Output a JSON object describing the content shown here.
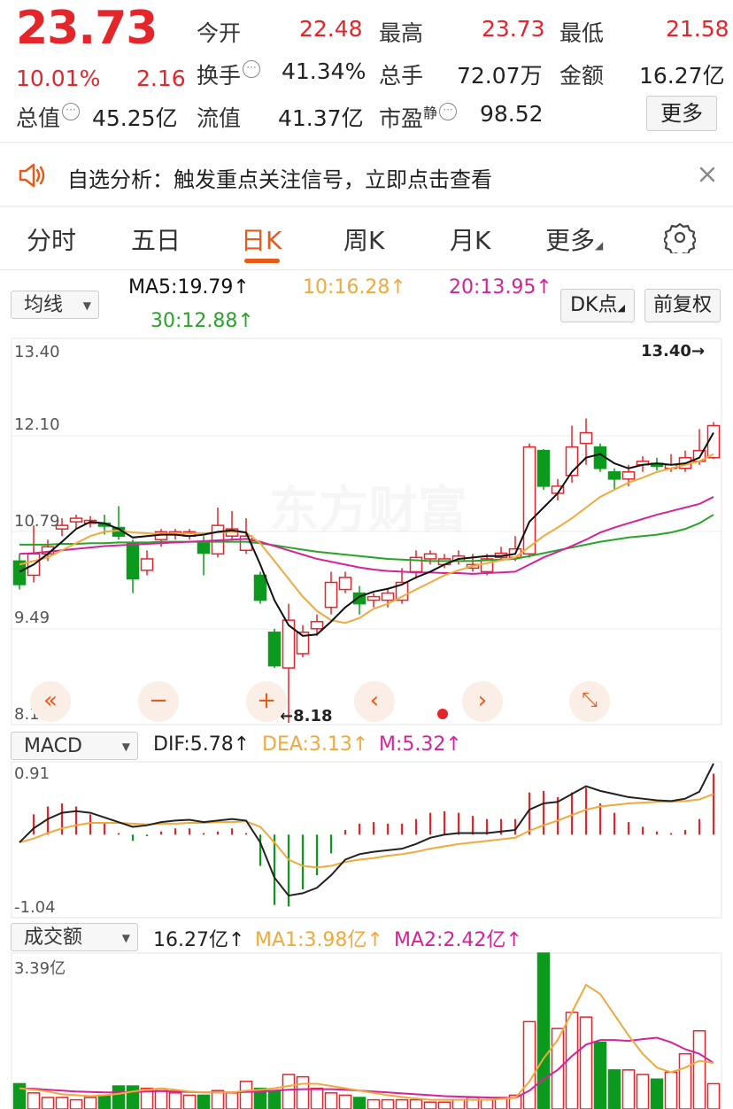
{
  "quote": {
    "price": "23.73",
    "change_pct": "10.01%",
    "change_amt": "2.16",
    "stats": [
      {
        "label": "今开",
        "value": "22.48"
      },
      {
        "label": "最高",
        "value": "23.73"
      },
      {
        "label": "最低",
        "value": "21.58"
      },
      {
        "label": "换手",
        "value": "41.34%"
      },
      {
        "label": "总手",
        "value": "72.07万"
      },
      {
        "label": "金额",
        "value": "16.27亿"
      },
      {
        "label": "总值",
        "value": "45.25亿"
      },
      {
        "label": "流值",
        "value": "41.37亿"
      },
      {
        "label": "市盈",
        "value": "98.52"
      }
    ],
    "pe_superscript": "静",
    "more_label": "更多"
  },
  "banner": {
    "text": "自选分析：触发重点关注信号，立即点击查看",
    "icon": "speaker-icon",
    "close_icon": "close-icon"
  },
  "tabs": [
    "分时",
    "五日",
    "日K",
    "周K",
    "月K",
    "更多"
  ],
  "active_tab": "日K",
  "settings_icon": "gear-icon",
  "kline": {
    "selector": "均线",
    "ma5": "MA5:19.79",
    "ma10": "10:16.28",
    "ma20": "20:13.95",
    "ma30": "30:12.88",
    "dk_button": "DK点",
    "adjust_button": "前复权",
    "y_labels": [
      "13.40",
      "12.10",
      "10.79",
      "9.49",
      "8.18"
    ],
    "max_marker": "13.40",
    "min_marker": "8.18",
    "watermark": "东方财富"
  },
  "controls": [
    "rewind-icon",
    "zoom-out-icon",
    "zoom-in-icon",
    "prev-icon",
    "next-icon",
    "fullscreen-icon"
  ],
  "macd": {
    "selector": "MACD",
    "dif": "DIF:5.78",
    "dea": "DEA:3.13",
    "m": "M:5.32",
    "y_top": "0.91",
    "y_bottom": "-1.04"
  },
  "volume": {
    "selector": "成交额",
    "value": "16.27亿",
    "ma1": "MA1:3.98亿",
    "ma2": "MA2:2.42亿",
    "y_top": "3.39亿"
  },
  "colors": {
    "up": "#e4262a",
    "down": "#0b9a1d",
    "ma5": "#111111",
    "ma10": "#f2a93b",
    "ma20": "#d4239a",
    "ma30": "#28a428",
    "accent": "#e85a18"
  },
  "chart_data": {
    "type": "candlestick",
    "y_range": [
      8.18,
      13.4
    ],
    "candles": [
      {
        "o": 10.45,
        "c": 10.12,
        "h": 10.55,
        "l": 10.05
      },
      {
        "o": 10.25,
        "c": 10.55,
        "h": 10.95,
        "l": 10.15
      },
      {
        "o": 10.55,
        "c": 10.65,
        "h": 10.75,
        "l": 10.45
      },
      {
        "o": 10.9,
        "c": 10.95,
        "h": 11.05,
        "l": 10.8
      },
      {
        "o": 11.0,
        "c": 11.05,
        "h": 11.1,
        "l": 10.9
      },
      {
        "o": 10.98,
        "c": 11.02,
        "h": 11.08,
        "l": 10.92
      },
      {
        "o": 10.98,
        "c": 10.94,
        "h": 11.1,
        "l": 10.82
      },
      {
        "o": 10.92,
        "c": 10.8,
        "h": 11.22,
        "l": 10.75
      },
      {
        "o": 10.7,
        "c": 10.2,
        "h": 10.75,
        "l": 10.0
      },
      {
        "o": 10.32,
        "c": 10.48,
        "h": 10.6,
        "l": 10.25
      },
      {
        "o": 10.75,
        "c": 10.86,
        "h": 10.9,
        "l": 10.65
      },
      {
        "o": 10.82,
        "c": 10.86,
        "h": 10.9,
        "l": 10.75
      },
      {
        "o": 10.8,
        "c": 10.86,
        "h": 10.9,
        "l": 10.75
      },
      {
        "o": 10.72,
        "c": 10.56,
        "h": 10.8,
        "l": 10.25
      },
      {
        "o": 10.55,
        "c": 10.95,
        "h": 11.2,
        "l": 10.5
      },
      {
        "o": 10.8,
        "c": 10.9,
        "h": 11.15,
        "l": 10.75
      },
      {
        "o": 10.6,
        "c": 10.8,
        "h": 11.05,
        "l": 10.55
      },
      {
        "o": 10.25,
        "c": 9.9,
        "h": 10.3,
        "l": 9.85
      },
      {
        "o": 9.45,
        "c": 8.98,
        "h": 9.5,
        "l": 8.95
      },
      {
        "o": 8.95,
        "c": 9.62,
        "h": 9.85,
        "l": 8.18
      },
      {
        "o": 9.15,
        "c": 9.45,
        "h": 9.55,
        "l": 9.1
      },
      {
        "o": 9.5,
        "c": 9.6,
        "h": 9.7,
        "l": 9.4
      },
      {
        "o": 9.8,
        "c": 10.15,
        "h": 10.3,
        "l": 9.7
      },
      {
        "o": 10.05,
        "c": 10.22,
        "h": 10.3,
        "l": 10.0
      },
      {
        "o": 10.0,
        "c": 9.85,
        "h": 10.1,
        "l": 9.7
      },
      {
        "o": 9.9,
        "c": 9.95,
        "h": 10.0,
        "l": 9.8
      },
      {
        "o": 9.9,
        "c": 10.0,
        "h": 10.05,
        "l": 9.8
      },
      {
        "o": 9.9,
        "c": 10.15,
        "h": 10.35,
        "l": 9.85
      },
      {
        "o": 10.3,
        "c": 10.5,
        "h": 10.6,
        "l": 10.2
      },
      {
        "o": 10.48,
        "c": 10.55,
        "h": 10.6,
        "l": 10.4
      },
      {
        "o": 10.4,
        "c": 10.48,
        "h": 10.55,
        "l": 10.35
      },
      {
        "o": 10.45,
        "c": 10.52,
        "h": 10.6,
        "l": 10.4
      },
      {
        "o": 10.35,
        "c": 10.4,
        "h": 10.55,
        "l": 10.3
      },
      {
        "o": 10.3,
        "c": 10.48,
        "h": 10.55,
        "l": 10.25
      },
      {
        "o": 10.5,
        "c": 10.56,
        "h": 10.65,
        "l": 10.45
      },
      {
        "o": 10.5,
        "c": 10.62,
        "h": 10.8,
        "l": 10.45
      },
      {
        "o": 10.55,
        "c": 12.05,
        "h": 12.1,
        "l": 10.5
      },
      {
        "o": 12.0,
        "c": 11.5,
        "h": 12.02,
        "l": 11.45
      },
      {
        "o": 11.4,
        "c": 11.5,
        "h": 11.6,
        "l": 11.3
      },
      {
        "o": 11.65,
        "c": 12.05,
        "h": 12.35,
        "l": 11.55
      },
      {
        "o": 12.1,
        "c": 12.25,
        "h": 12.45,
        "l": 11.8
      },
      {
        "o": 12.05,
        "c": 11.75,
        "h": 12.1,
        "l": 11.7
      },
      {
        "o": 11.7,
        "c": 11.6,
        "h": 11.75,
        "l": 11.45
      },
      {
        "o": 11.6,
        "c": 11.7,
        "h": 11.8,
        "l": 11.5
      },
      {
        "o": 11.8,
        "c": 11.85,
        "h": 11.92,
        "l": 11.7
      },
      {
        "o": 11.82,
        "c": 11.78,
        "h": 11.9,
        "l": 11.72
      },
      {
        "o": 11.75,
        "c": 11.8,
        "h": 11.95,
        "l": 11.7
      },
      {
        "o": 11.75,
        "c": 11.9,
        "h": 12.0,
        "l": 11.7
      },
      {
        "o": 11.85,
        "c": 12.0,
        "h": 12.3,
        "l": 11.8
      },
      {
        "o": 11.9,
        "c": 12.35,
        "h": 12.4,
        "l": 11.88
      }
    ],
    "ma5": [
      10.3,
      10.4,
      10.55,
      10.72,
      10.9,
      11.0,
      10.98,
      10.9,
      10.78,
      10.8,
      10.82,
      10.82,
      10.8,
      10.82,
      10.86,
      10.88,
      10.85,
      10.4,
      9.9,
      9.55,
      9.4,
      9.42,
      9.6,
      9.8,
      9.95,
      10.02,
      10.06,
      10.12,
      10.22,
      10.3,
      10.4,
      10.48,
      10.5,
      10.52,
      10.52,
      10.55,
      11.0,
      11.2,
      11.4,
      11.7,
      11.9,
      11.95,
      11.82,
      11.75,
      11.8,
      11.82,
      11.8,
      11.82,
      11.9,
      12.25
    ],
    "ma10": [
      10.4,
      10.45,
      10.5,
      10.6,
      10.7,
      10.8,
      10.86,
      10.88,
      10.85,
      10.84,
      10.83,
      10.83,
      10.84,
      10.84,
      10.85,
      10.86,
      10.85,
      10.7,
      10.45,
      10.2,
      9.95,
      9.75,
      9.62,
      9.58,
      9.65,
      9.78,
      9.85,
      9.95,
      10.05,
      10.15,
      10.25,
      10.32,
      10.38,
      10.42,
      10.46,
      10.5,
      10.65,
      10.8,
      10.92,
      11.05,
      11.2,
      11.35,
      11.45,
      11.55,
      11.62,
      11.7,
      11.75,
      11.8,
      11.85,
      11.95
    ],
    "ma20": [
      10.55,
      10.56,
      10.58,
      10.6,
      10.62,
      10.64,
      10.66,
      10.67,
      10.68,
      10.69,
      10.7,
      10.71,
      10.72,
      10.73,
      10.74,
      10.75,
      10.76,
      10.72,
      10.66,
      10.6,
      10.54,
      10.48,
      10.44,
      10.4,
      10.36,
      10.33,
      10.31,
      10.3,
      10.29,
      10.29,
      10.28,
      10.28,
      10.27,
      10.28,
      10.29,
      10.3,
      10.4,
      10.5,
      10.58,
      10.66,
      10.75,
      10.85,
      10.92,
      10.98,
      11.04,
      11.1,
      11.15,
      11.2,
      11.25,
      11.35
    ],
    "ma30": [
      10.68,
      10.68,
      10.68,
      10.69,
      10.69,
      10.7,
      10.7,
      10.71,
      10.71,
      10.71,
      10.72,
      10.72,
      10.72,
      10.72,
      10.72,
      10.72,
      10.72,
      10.7,
      10.67,
      10.64,
      10.61,
      10.58,
      10.56,
      10.54,
      10.52,
      10.5,
      10.48,
      10.47,
      10.46,
      10.45,
      10.45,
      10.45,
      10.45,
      10.46,
      10.47,
      10.48,
      10.52,
      10.56,
      10.6,
      10.64,
      10.68,
      10.72,
      10.75,
      10.78,
      10.8,
      10.82,
      10.85,
      10.9,
      10.98,
      11.1
    ],
    "macd_dif": [
      -0.1,
      0.08,
      0.2,
      0.28,
      0.3,
      0.28,
      0.22,
      0.16,
      0.1,
      0.12,
      0.16,
      0.18,
      0.19,
      0.16,
      0.18,
      0.2,
      0.18,
      -0.1,
      -0.55,
      -0.78,
      -0.75,
      -0.68,
      -0.52,
      -0.32,
      -0.25,
      -0.22,
      -0.2,
      -0.18,
      -0.12,
      -0.04,
      0.0,
      0.02,
      0.02,
      0.02,
      0.04,
      0.06,
      0.32,
      0.4,
      0.42,
      0.52,
      0.62,
      0.56,
      0.52,
      0.48,
      0.46,
      0.44,
      0.43,
      0.46,
      0.55,
      0.91
    ],
    "macd_dea": [
      -0.1,
      -0.05,
      0.02,
      0.08,
      0.12,
      0.15,
      0.15,
      0.15,
      0.14,
      0.13,
      0.14,
      0.14,
      0.15,
      0.15,
      0.16,
      0.16,
      0.17,
      0.1,
      -0.1,
      -0.32,
      -0.4,
      -0.42,
      -0.4,
      -0.35,
      -0.32,
      -0.3,
      -0.27,
      -0.25,
      -0.22,
      -0.18,
      -0.15,
      -0.12,
      -0.1,
      -0.08,
      -0.06,
      -0.04,
      0.05,
      0.12,
      0.18,
      0.25,
      0.32,
      0.36,
      0.38,
      0.4,
      0.41,
      0.42,
      0.42,
      0.43,
      0.45,
      0.52
    ],
    "volume_bars": [
      0.55,
      0.35,
      0.25,
      0.25,
      0.2,
      0.25,
      0.3,
      0.5,
      0.5,
      0.45,
      0.4,
      0.35,
      0.3,
      0.3,
      0.4,
      0.35,
      0.6,
      0.45,
      0.4,
      0.75,
      0.7,
      0.45,
      0.35,
      0.3,
      0.25,
      0.2,
      0.2,
      0.2,
      0.2,
      0.15,
      0.15,
      0.2,
      0.25,
      0.2,
      0.25,
      0.3,
      1.9,
      3.39,
      1.75,
      2.1,
      2.0,
      1.45,
      0.85,
      0.85,
      0.75,
      0.65,
      0.8,
      1.2,
      1.7,
      0.55
    ],
    "volume_ma1": [
      0.45,
      0.42,
      0.38,
      0.32,
      0.3,
      0.28,
      0.3,
      0.33,
      0.38,
      0.42,
      0.45,
      0.42,
      0.38,
      0.36,
      0.36,
      0.36,
      0.4,
      0.42,
      0.45,
      0.5,
      0.55,
      0.55,
      0.5,
      0.45,
      0.4,
      0.35,
      0.3,
      0.26,
      0.23,
      0.2,
      0.2,
      0.2,
      0.2,
      0.2,
      0.22,
      0.24,
      0.6,
      1.1,
      1.5,
      2.1,
      2.7,
      2.5,
      2.05,
      1.6,
      1.2,
      0.9,
      0.8,
      0.9,
      1.05,
      1.0
    ],
    "volume_ma2": [
      0.45,
      0.44,
      0.42,
      0.4,
      0.38,
      0.37,
      0.36,
      0.36,
      0.37,
      0.38,
      0.39,
      0.38,
      0.37,
      0.36,
      0.36,
      0.36,
      0.37,
      0.38,
      0.4,
      0.42,
      0.43,
      0.43,
      0.43,
      0.42,
      0.4,
      0.38,
      0.36,
      0.34,
      0.32,
      0.3,
      0.28,
      0.27,
      0.26,
      0.25,
      0.24,
      0.24,
      0.4,
      0.65,
      0.85,
      1.15,
      1.4,
      1.5,
      1.5,
      1.48,
      1.52,
      1.55,
      1.45,
      1.3,
      1.2,
      1.0
    ],
    "volume_max": 3.39
  }
}
